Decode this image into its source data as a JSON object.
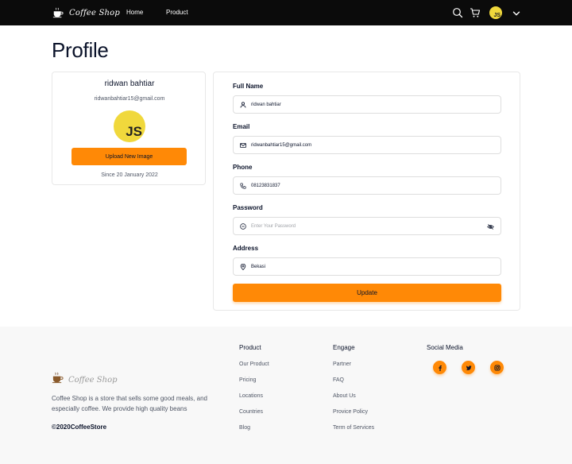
{
  "navbar": {
    "brand": "Coffee Shop",
    "links": [
      {
        "label": "Home"
      },
      {
        "label": "Product"
      }
    ],
    "avatar_text": "JS",
    "icons": [
      "search-icon",
      "cart-icon",
      "chevron-down-icon"
    ]
  },
  "page": {
    "title": "Profile"
  },
  "profile_card": {
    "name": "ridwan bahtiar",
    "email": "ridwanbahtiar15@gmail.com",
    "avatar_text": "JS",
    "upload_label": "Upload New Image",
    "since": "Since 20 January 2022"
  },
  "form": {
    "fields": [
      {
        "label": "Full Name",
        "value": "ridwan bahtiar",
        "icon": "user-icon"
      },
      {
        "label": "Email",
        "value": "ridwanbahtiar15@gmail.com",
        "icon": "mail-icon"
      },
      {
        "label": "Phone",
        "value": "08123831837",
        "icon": "phone-icon"
      },
      {
        "label": "Password",
        "placeholder": "Enter Your Password",
        "icon": "lock-icon"
      },
      {
        "label": "Address",
        "value": "Bekasi",
        "icon": "location-icon"
      }
    ],
    "submit_label": "Update"
  },
  "footer": {
    "brand": "Coffee Shop",
    "description": "Coffee Shop is a store that sells some good meals, and especially coffee. We provide high quality beans",
    "copyright": "©2020CoffeeStore",
    "product": {
      "title": "Product",
      "links": [
        "Our Product",
        "Pricing",
        "Locations",
        "Countries",
        "Blog"
      ]
    },
    "engage": {
      "title": "Engage",
      "links": [
        "Partner",
        "FAQ",
        "About Us",
        "Provice Policy",
        "Term of Services"
      ]
    },
    "social": {
      "title": "Social Media",
      "icons": [
        "facebook-icon",
        "twitter-icon",
        "instagram-icon"
      ]
    }
  },
  "colors": {
    "accent": "#ff8906",
    "navbar_bg": "#0b0b0b",
    "avatar_bg": "#f0d83c",
    "footer_bg": "#f8f8f8"
  }
}
